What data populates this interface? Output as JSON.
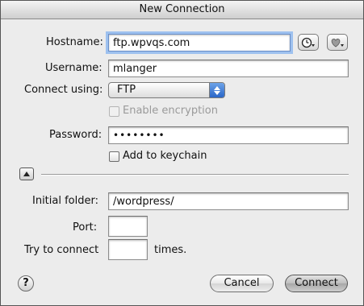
{
  "window": {
    "title": "New Connection"
  },
  "hostname": {
    "label": "Hostname:",
    "value": "ftp.wpvqs.com"
  },
  "username": {
    "label": "Username:",
    "value": "mlanger"
  },
  "connect_using": {
    "label": "Connect using:",
    "selected": "FTP"
  },
  "encryption": {
    "label": "Enable encryption",
    "checked": false,
    "enabled": false
  },
  "password": {
    "label": "Password:",
    "masked": "••••••••"
  },
  "keychain": {
    "label": "Add to keychain",
    "checked": false
  },
  "initial_folder": {
    "label": "Initial folder:",
    "value": "/wordpress/"
  },
  "port": {
    "label": "Port:",
    "value": ""
  },
  "retry": {
    "label_before": "Try to connect",
    "value": "",
    "label_after": "times."
  },
  "buttons": {
    "help": "?",
    "cancel": "Cancel",
    "connect": "Connect"
  },
  "icons": {
    "history": "clock-icon",
    "favorites": "heart-icon"
  }
}
